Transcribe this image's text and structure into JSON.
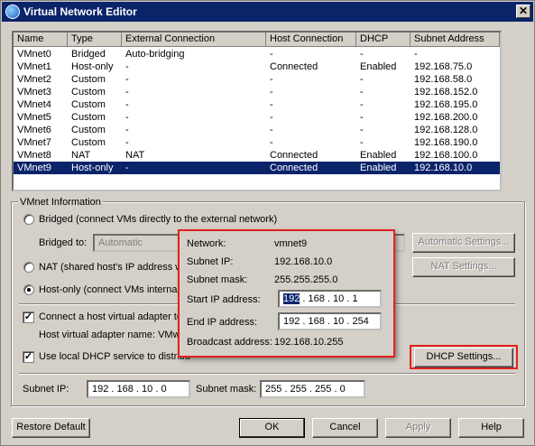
{
  "window": {
    "title": "Virtual Network Editor",
    "close_glyph": "✕"
  },
  "table": {
    "headers": [
      "Name",
      "Type",
      "External Connection",
      "Host Connection",
      "DHCP",
      "Subnet Address"
    ],
    "rows": [
      [
        "VMnet0",
        "Bridged",
        "Auto-bridging",
        "-",
        "-",
        "-"
      ],
      [
        "VMnet1",
        "Host-only",
        "-",
        "Connected",
        "Enabled",
        "192.168.75.0"
      ],
      [
        "VMnet2",
        "Custom",
        "-",
        "-",
        "-",
        "192.168.58.0"
      ],
      [
        "VMnet3",
        "Custom",
        "-",
        "-",
        "-",
        "192.168.152.0"
      ],
      [
        "VMnet4",
        "Custom",
        "-",
        "-",
        "-",
        "192.168.195.0"
      ],
      [
        "VMnet5",
        "Custom",
        "-",
        "-",
        "-",
        "192.168.200.0"
      ],
      [
        "VMnet6",
        "Custom",
        "-",
        "-",
        "-",
        "192.168.128.0"
      ],
      [
        "VMnet7",
        "Custom",
        "-",
        "-",
        "-",
        "192.168.190.0"
      ],
      [
        "VMnet8",
        "NAT",
        "NAT",
        "Connected",
        "Enabled",
        "192.168.100.0"
      ],
      [
        "VMnet9",
        "Host-only",
        "-",
        "Connected",
        "Enabled",
        "192.168.10.0"
      ]
    ],
    "selected_row": 9
  },
  "vmnet_info": {
    "group_title": "VMnet Information",
    "bridged_label": "Bridged (connect VMs directly to the external network)",
    "bridged_to_label": "Bridged to:",
    "bridged_to_value": "Automatic",
    "automatic_settings": "Automatic Settings...",
    "nat_label": "NAT (shared host's IP address w",
    "nat_settings": "NAT Settings...",
    "hostonly_label": "Host-only (connect VMs internall",
    "connect_adapter_label": "Connect a host virtual adapter to",
    "adapter_name_label": "Host virtual adapter name: VMw",
    "dhcp_label": "Use local DHCP service to distribu",
    "dhcp_settings": "DHCP Settings...",
    "subnet_ip_label": "Subnet IP:",
    "subnet_ip_value": "192 . 168 . 10 . 0",
    "subnet_mask_label": "Subnet mask:",
    "subnet_mask_value": "255 . 255 . 255 . 0"
  },
  "popup": {
    "network_label": "Network:",
    "network_value": "vmnet9",
    "subnet_ip_label": "Subnet IP:",
    "subnet_ip_value": "192.168.10.0",
    "subnet_mask_label": "Subnet mask:",
    "subnet_mask_value": "255.255.255.0",
    "start_ip_label": "Start IP address:",
    "start_ip_first": "192",
    "start_ip_rest": " . 168 . 10 . 1",
    "end_ip_label": "End IP address:",
    "end_ip_value": "192 . 168 . 10 . 254",
    "broadcast_label": "Broadcast address:",
    "broadcast_value": "192.168.10.255"
  },
  "footer": {
    "restore_default": "Restore Default",
    "ok": "OK",
    "cancel": "Cancel",
    "apply": "Apply",
    "help": "Help"
  },
  "colors": {
    "selection": "#0a246a",
    "highlight": "#e02020",
    "face": "#d4d0c8"
  }
}
